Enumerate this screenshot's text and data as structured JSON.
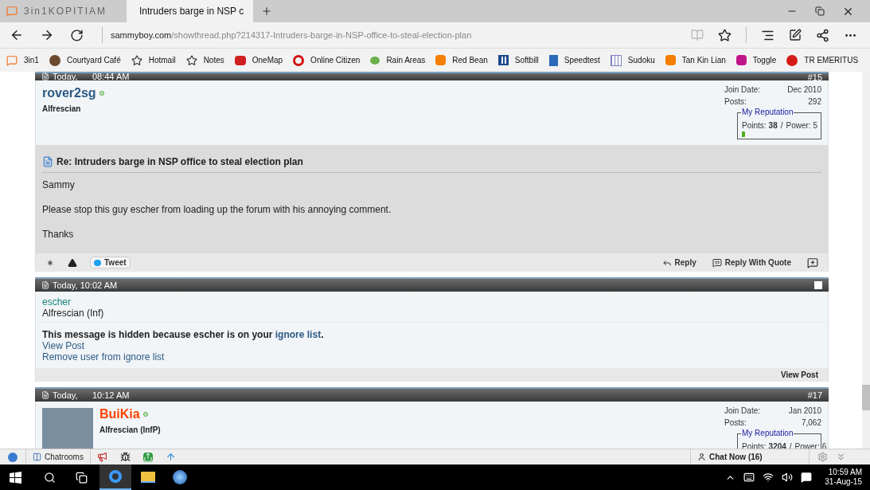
{
  "browser": {
    "tabs": [
      {
        "label": "3in1KOPITIAM",
        "selected": false
      },
      {
        "label": "Intruders barge in NSP c",
        "selected": true
      }
    ],
    "address": {
      "domain": "sammyboy.com",
      "path": "/showthread.php?214317-Intruders-barge-in-NSP-office-to-steal-election-plan"
    },
    "favorites": [
      {
        "label": "3in1"
      },
      {
        "label": "Courtyard Café"
      },
      {
        "label": "Hotmail"
      },
      {
        "label": "Notes"
      },
      {
        "label": "OneMap"
      },
      {
        "label": "Online Citizen"
      },
      {
        "label": "Rain Areas"
      },
      {
        "label": "Red Bean"
      },
      {
        "label": "Softbill"
      },
      {
        "label": "Speedtest"
      },
      {
        "label": "Sudoku"
      },
      {
        "label": "Tan Kin Lian"
      },
      {
        "label": "Toggle"
      },
      {
        "label": "TR EMERITUS"
      }
    ]
  },
  "posts": [
    {
      "kind": "full",
      "date": "Today,",
      "time": "08:44 AM",
      "number": "#15",
      "username": "rover2sg",
      "color": "#2d5a84",
      "online": true,
      "avatar": false,
      "user_title": "Alfrescian",
      "join_label": "Join Date:",
      "join_date": "Dec 2010",
      "posts_label": "Posts:",
      "posts_count": "292",
      "reputation": {
        "legend": "My Reputation",
        "points_label": "Points:",
        "points": "38",
        "separator": "/",
        "power_label": "Power:",
        "power": "5"
      },
      "title": "Re: Intruders barge in NSP office to steal election plan",
      "body": [
        "Sammy",
        "Please stop this guy escher from loading up the forum with his annoying comment.",
        "Thanks"
      ],
      "tweet": "Tweet",
      "reply": "Reply",
      "reply_quote": "Reply With Quote"
    },
    {
      "kind": "hidden",
      "date": "Today, 10:02 AM",
      "checked": false,
      "username": "escher",
      "user_title": "Alfrescian (Inf)",
      "message": "This message is hidden because escher is on your ",
      "ignore_link": "ignore list",
      "message_end": ".",
      "view_post": "View Post",
      "remove": "Remove user from ignore list",
      "footer_view": "View Post"
    },
    {
      "kind": "full",
      "date": "Today,",
      "time": "10:12 AM",
      "number": "#17",
      "username": "BuiKia",
      "color": "#ff4400",
      "online": true,
      "avatar": true,
      "user_title": "Alfrescian (InfP)",
      "join_label": "Join Date:",
      "join_date": "Jan 2010",
      "posts_label": "Posts:",
      "posts_count": "7,062",
      "reputation": {
        "legend": "My Reputation",
        "points_label": "Points:",
        "points": "3204",
        "separator": "/",
        "power_label": "Power:",
        "power": "6"
      }
    }
  ],
  "chat_bar": {
    "rooms": "Chatrooms",
    "chat_now": "Chat Now (16)"
  },
  "taskbar": {
    "time": "10:59 AM",
    "date": "31-Aug-15"
  }
}
